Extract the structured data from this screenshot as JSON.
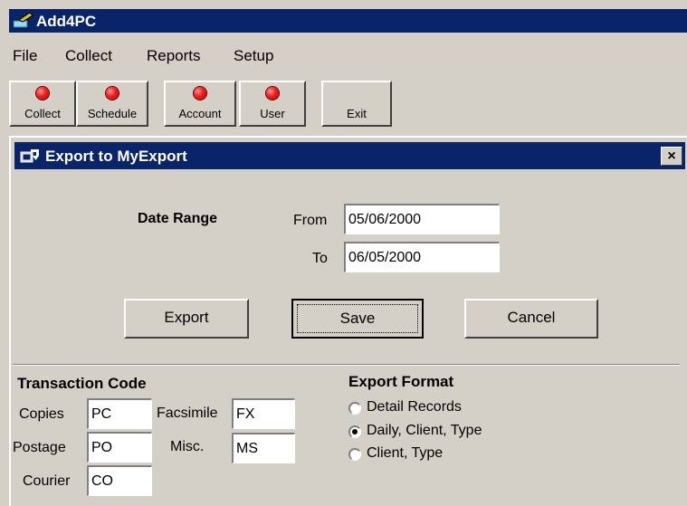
{
  "window": {
    "title": "Add4PC"
  },
  "menu": {
    "items": [
      "File",
      "Collect",
      "Reports",
      "Setup"
    ]
  },
  "toolbar": {
    "buttons": [
      "Collect",
      "Schedule",
      "Account",
      "User",
      "Exit"
    ]
  },
  "dialog": {
    "title": "Export to MyExport",
    "close_glyph": "×",
    "date_range": {
      "heading": "Date Range",
      "from_label": "From",
      "from_value": "05/06/2000",
      "to_label": "To",
      "to_value": "06/05/2000"
    },
    "buttons": {
      "export": "Export",
      "save": "Save",
      "cancel": "Cancel"
    },
    "transaction_code": {
      "heading": "Transaction Code",
      "copies_label": "Copies",
      "copies_value": "PC",
      "postage_label": "Postage",
      "postage_value": "PO",
      "courier_label": "Courier",
      "courier_value": "CO",
      "facsimile_label": "Facsimile",
      "facsimile_value": "FX",
      "misc_label": "Misc.",
      "misc_value": "MS"
    },
    "export_format": {
      "heading": "Export Format",
      "options": [
        "Detail Records",
        "Daily, Client, Type",
        "Client, Type"
      ],
      "selected": "Daily, Client, Type"
    }
  },
  "colors": {
    "title_bar": "#0a246a",
    "face": "#d4d0c8",
    "led_red": "#ff2020"
  }
}
